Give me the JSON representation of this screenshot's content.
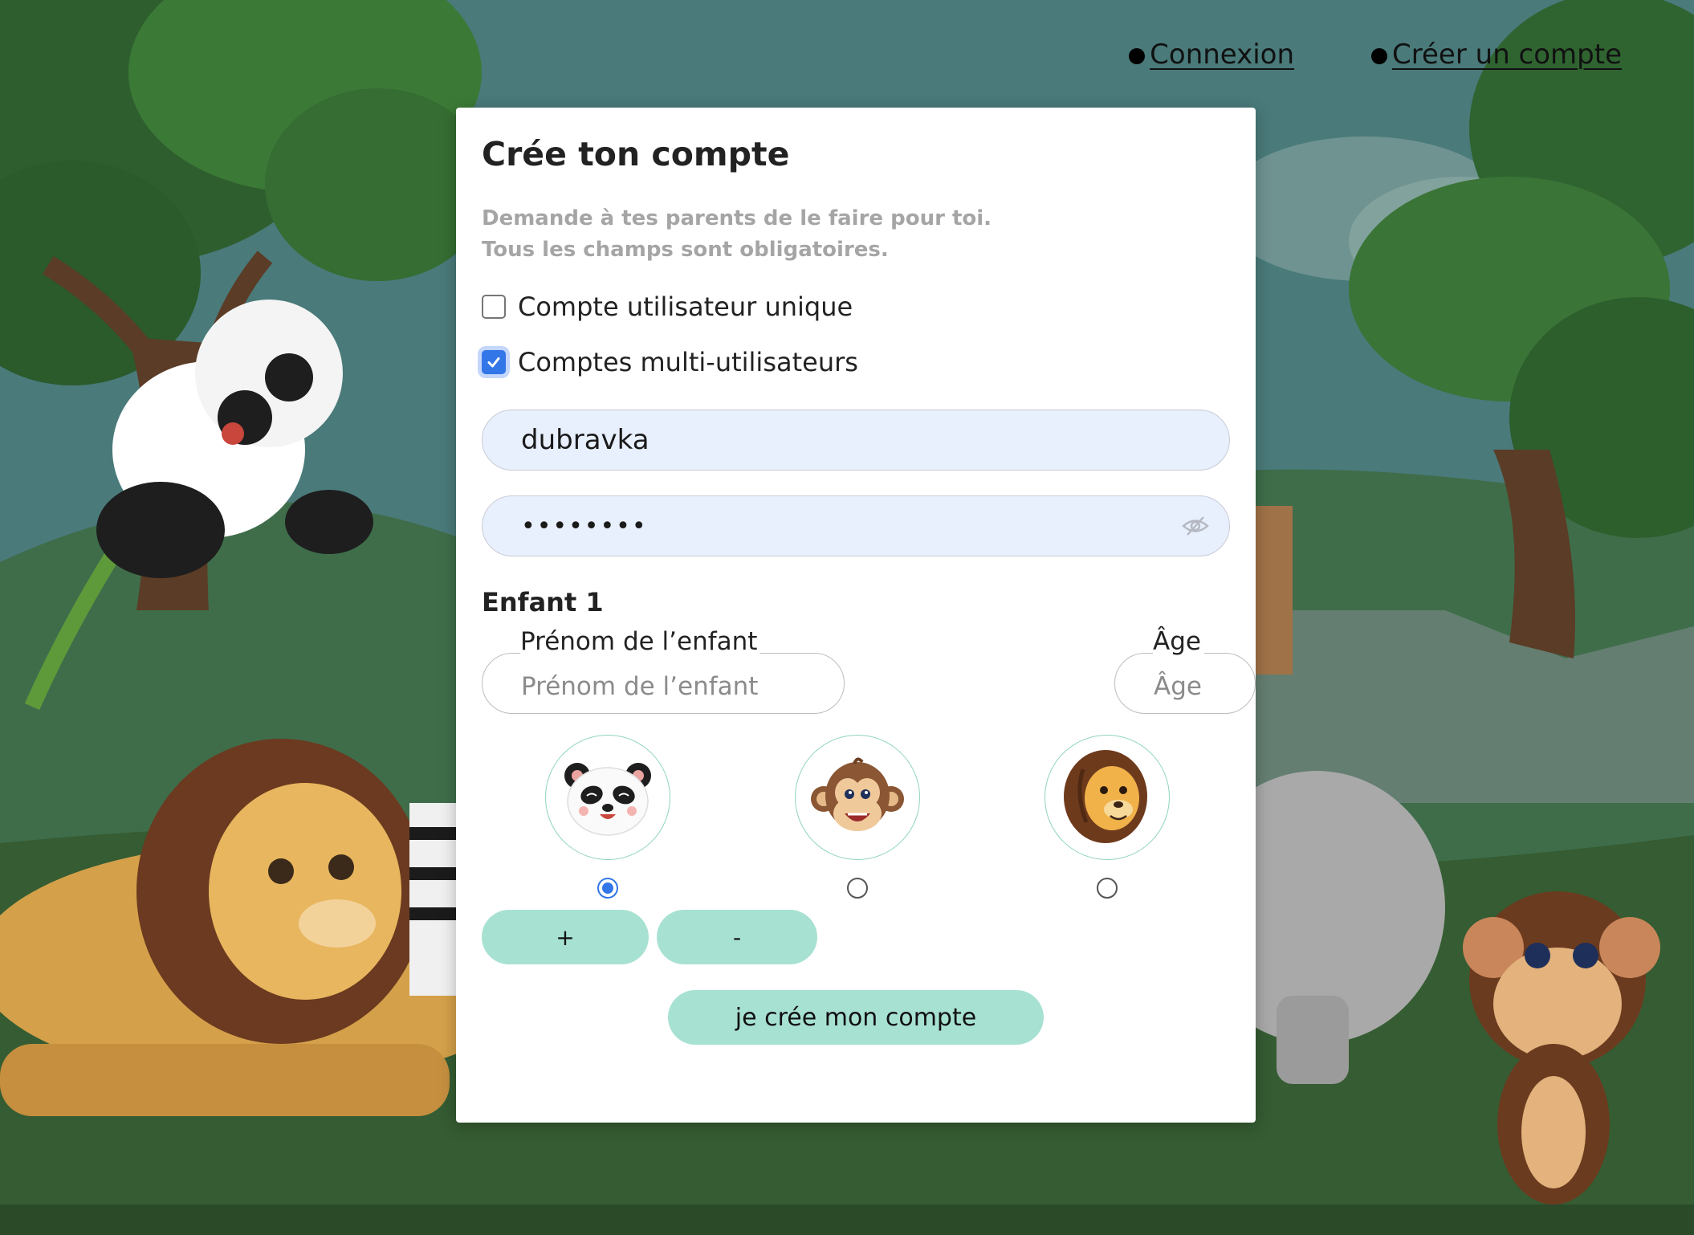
{
  "nav": {
    "login_label": "Connexion",
    "signup_label": "Créer un compte"
  },
  "form": {
    "title": "Crée ton compte",
    "subtitle_line1": "Demande à tes parents de le faire pour toi.",
    "subtitle_line2": "Tous les champs sont obligatoires.",
    "account_types": [
      {
        "label": "Compte utilisateur unique",
        "checked": false
      },
      {
        "label": "Comptes multi-utilisateurs",
        "checked": true
      }
    ],
    "username_value": "dubravka",
    "password_value": "••••••••",
    "child_section_title": "Enfant 1",
    "child_name": {
      "label": "Prénom de l’enfant",
      "placeholder": "Prénom de l’enfant"
    },
    "child_age": {
      "label": "Âge",
      "placeholder": "Âge"
    },
    "avatars": [
      {
        "icon": "panda-avatar-icon",
        "selected": true
      },
      {
        "icon": "monkey-avatar-icon",
        "selected": false
      },
      {
        "icon": "lion-avatar-icon",
        "selected": false
      }
    ],
    "add_child_label": "+",
    "remove_child_label": "-",
    "submit_label": "je crée mon compte"
  },
  "colors": {
    "accent_mint": "#a7e1d2",
    "checkbox_blue": "#3276e8",
    "input_fill": "#e8effd"
  }
}
